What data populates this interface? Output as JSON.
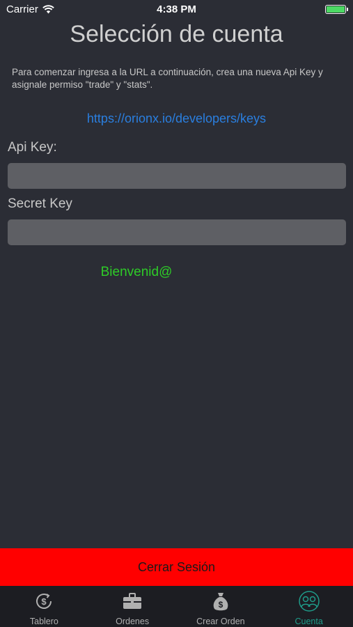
{
  "status_bar": {
    "carrier": "Carrier",
    "time": "4:38 PM",
    "battery_level": 1.0,
    "battery_color": "#4cd964"
  },
  "page": {
    "title": "Selección de cuenta",
    "intro": "Para comenzar ingresa a la URL a continuación, crea una nueva Api Key y asignale permiso \"trade\" y \"stats\".",
    "link": "https://orionx.io/developers/keys"
  },
  "form": {
    "api_key_label": "Api Key:",
    "api_key_value": "",
    "secret_key_label": "Secret Key",
    "secret_key_value": ""
  },
  "welcome": "Bienvenid@",
  "logout_label": "Cerrar Sesión",
  "tabs": [
    {
      "label": "Tablero",
      "icon": "dollar-circle-icon",
      "active": false
    },
    {
      "label": "Ordenes",
      "icon": "briefcase-icon",
      "active": false
    },
    {
      "label": "Crear Orden",
      "icon": "money-bag-icon",
      "active": false
    },
    {
      "label": "Cuenta",
      "icon": "users-icon",
      "active": true
    }
  ],
  "colors": {
    "background": "#2b2d35",
    "link": "#2a7fe0",
    "welcome": "#2ecc28",
    "logout": "#ff0000",
    "tab_active": "#1f9c8a"
  }
}
